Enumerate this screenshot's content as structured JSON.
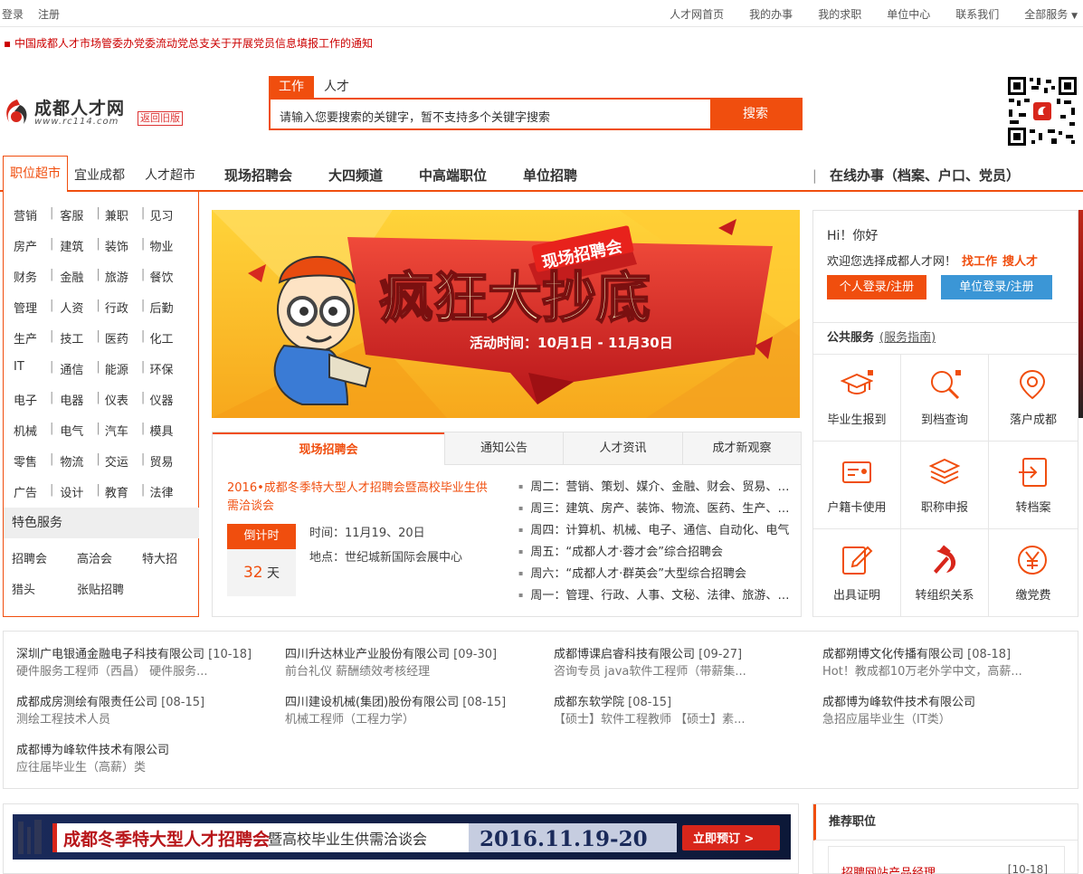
{
  "topbar": {
    "login": "登录",
    "register": "注册",
    "links": [
      "人才网首页",
      "我的办事",
      "我的求职",
      "单位中心",
      "联系我们",
      "全部服务"
    ]
  },
  "notice": "中国成都人才市场管委办党委流动党总支关于开展党员信息填报工作的通知",
  "logo": {
    "brand": "成都人才网",
    "domain": "www.rc114.com",
    "old_version": "返回旧版"
  },
  "search": {
    "tabs": [
      "工作",
      "人才"
    ],
    "placeholder": "请输入您要搜索的关键字，暂不支持多个关键字搜索",
    "button": "搜索"
  },
  "nav": {
    "category": "职位超市",
    "items": [
      "宜业成都",
      "人才超市"
    ],
    "bold_items": [
      "现场招聘会",
      "大四频道",
      "中高端职位",
      "单位招聘"
    ],
    "right": "在线办事（档案、户口、党员）"
  },
  "categories": [
    [
      "营销",
      "客服",
      "兼职",
      "见习"
    ],
    [
      "房产",
      "建筑",
      "装饰",
      "物业"
    ],
    [
      "财务",
      "金融",
      "旅游",
      "餐饮"
    ],
    [
      "管理",
      "人资",
      "行政",
      "后勤"
    ],
    [
      "生产",
      "技工",
      "医药",
      "化工"
    ],
    [
      "IT",
      "通信",
      "能源",
      "环保"
    ],
    [
      "电子",
      "电器",
      "仪表",
      "仪器"
    ],
    [
      "机械",
      "电气",
      "汽车",
      "模具"
    ],
    [
      "零售",
      "物流",
      "交运",
      "贸易"
    ],
    [
      "广告",
      "设计",
      "教育",
      "法律"
    ]
  ],
  "featured": {
    "title": "特色服务",
    "row1": [
      "招聘会",
      "高洽会",
      "特大招"
    ],
    "row2": [
      "猎头",
      "张贴招聘"
    ]
  },
  "banner": {
    "tag": "现场招聘会",
    "headline": "疯狂大抄底",
    "period": "活动时间：10月1日 - 11月30日"
  },
  "tabs": [
    "现场招聘会",
    "通知公告",
    "人才资讯",
    "成才新观察"
  ],
  "event": {
    "title": "2016•成都冬季特大型人才招聘会暨高校毕业生供需洽谈会",
    "countdown_label": "倒计时",
    "days": "32",
    "days_unit": "天",
    "time": "时间：11月19、20日",
    "place": "地点：世纪城新国际会展中心"
  },
  "schedule": [
    "周二：营销、策划、媒介、金融、财会、贸易、商务",
    "周三：建筑、房产、装饰、物流、医药、生产、制造",
    "周四：计算机、机械、电子、通信、自动化、电气",
    "周五：“成都人才·蓉才会”综合招聘会",
    "周六：“成都人才·群英会”大型综合招聘会",
    "周一：管理、行政、人事、文秘、法律、旅游、餐饮"
  ],
  "login": {
    "hi": "Hi！你好",
    "welcome": "欢迎您选择成都人才网！",
    "find_job": "找工作",
    "find_talent": "搜人才",
    "person_btn": "个人登录/注册",
    "company_btn": "单位登录/注册",
    "public_service": "公共服务",
    "guide": "(服务指南)"
  },
  "services": [
    "毕业生报到",
    "到档查询",
    "落户成都",
    "户籍卡使用",
    "职称申报",
    "转档案",
    "出具证明",
    "转组织关系",
    "缴党费"
  ],
  "companies": [
    {
      "name": "深圳广电银通金融电子科技有限公司",
      "date": "[10-18]",
      "jobs": "硬件服务工程师（西昌） 硬件服务..."
    },
    {
      "name": "四川升达林业产业股份有限公司",
      "date": "[09-30]",
      "jobs": "前台礼仪 薪酬绩效考核经理"
    },
    {
      "name": "成都博课启睿科技有限公司",
      "date": "[09-27]",
      "jobs": "咨询专员 java软件工程师（带薪集..."
    },
    {
      "name": "成都朔博文化传播有限公司",
      "date": "[08-18]",
      "jobs": "Hot！教成都10万老外学中文，高薪..."
    },
    {
      "name": "成都成房测绘有限责任公司",
      "date": "[08-15]",
      "jobs": "测绘工程技术人员"
    },
    {
      "name": "四川建设机械(集团)股份有限公司",
      "date": "[08-15]",
      "jobs": "机械工程师（工程力学）"
    },
    {
      "name": "成都东软学院",
      "date": "[08-15]",
      "jobs": "【硕士】软件工程教师 【硕士】素..."
    },
    {
      "name": "成都博为峰软件技术有限公司",
      "date": "",
      "jobs": "急招应届毕业生（IT类）"
    },
    {
      "name": "成都博为峰软件技术有限公司",
      "date": "",
      "jobs": "应往届毕业生（高薪）类"
    }
  ],
  "ad": {
    "title": "成都冬季特大型人才招聘会",
    "subtitle": "暨高校毕业生供需洽谈会",
    "date": "2016.11.19-20",
    "button": "立即预订 >"
  },
  "recommend": {
    "title": "推荐职位",
    "first_job": "招聘网站产品经理",
    "first_date": "[10-18]"
  },
  "colors": {
    "accent": "#f04e0e",
    "blue": "#3b96d6",
    "link_red": "#cc0000"
  }
}
